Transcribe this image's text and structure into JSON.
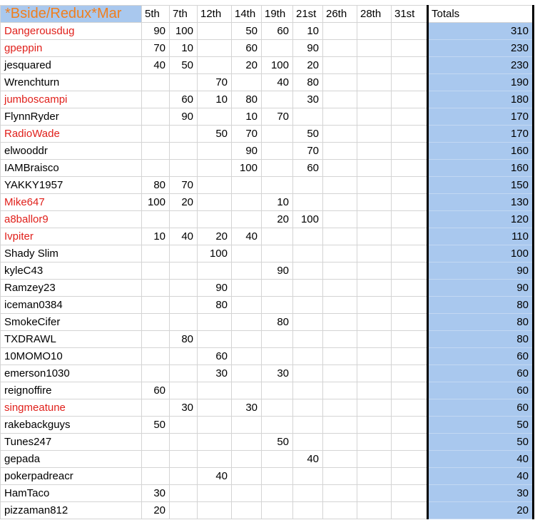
{
  "sheet": {
    "title": "*Bside/Redux*Mar",
    "columns": [
      "5th",
      "7th",
      "12th",
      "14th",
      "19th",
      "21st",
      "26th",
      "28th",
      "31st"
    ],
    "totals_label": "Totals",
    "rows": [
      {
        "name": "Dangerousdug",
        "red": true,
        "v": [
          "90",
          "100",
          "",
          "50",
          "60",
          "10",
          "",
          "",
          ""
        ],
        "total": "310"
      },
      {
        "name": "gpeppin",
        "red": true,
        "v": [
          "70",
          "10",
          "",
          "60",
          "",
          "90",
          "",
          "",
          ""
        ],
        "total": "230"
      },
      {
        "name": "jesquared",
        "red": false,
        "v": [
          "40",
          "50",
          "",
          "20",
          "100",
          "20",
          "",
          "",
          ""
        ],
        "total": "230"
      },
      {
        "name": "Wrenchturn",
        "red": false,
        "v": [
          "",
          "",
          "70",
          "",
          "40",
          "80",
          "",
          "",
          ""
        ],
        "total": "190"
      },
      {
        "name": "jumboscampi",
        "red": true,
        "v": [
          "",
          "60",
          "10",
          "80",
          "",
          "30",
          "",
          "",
          ""
        ],
        "total": "180"
      },
      {
        "name": "FlynnRyder",
        "red": false,
        "v": [
          "",
          "90",
          "",
          "10",
          "70",
          "",
          "",
          "",
          ""
        ],
        "total": "170"
      },
      {
        "name": "RadioWade",
        "red": true,
        "v": [
          "",
          "",
          "50",
          "70",
          "",
          "50",
          "",
          "",
          ""
        ],
        "total": "170"
      },
      {
        "name": "elwooddr",
        "red": false,
        "v": [
          "",
          "",
          "",
          "90",
          "",
          "70",
          "",
          "",
          ""
        ],
        "total": "160"
      },
      {
        "name": "IAMBraisco",
        "red": false,
        "v": [
          "",
          "",
          "",
          "100",
          "",
          "60",
          "",
          "",
          ""
        ],
        "total": "160"
      },
      {
        "name": "YAKKY1957",
        "red": false,
        "v": [
          "80",
          "70",
          "",
          "",
          "",
          "",
          "",
          "",
          ""
        ],
        "total": "150"
      },
      {
        "name": "Mike647",
        "red": true,
        "v": [
          "100",
          "20",
          "",
          "",
          "10",
          "",
          "",
          "",
          ""
        ],
        "total": "130"
      },
      {
        "name": "a8ballor9",
        "red": true,
        "v": [
          "",
          "",
          "",
          "",
          "20",
          "100",
          "",
          "",
          ""
        ],
        "total": "120"
      },
      {
        "name": "Ivpiter",
        "red": true,
        "v": [
          "10",
          "40",
          "20",
          "40",
          "",
          "",
          "",
          "",
          ""
        ],
        "total": "110"
      },
      {
        "name": "Shady Slim",
        "red": false,
        "v": [
          "",
          "",
          "100",
          "",
          "",
          "",
          "",
          "",
          ""
        ],
        "total": "100"
      },
      {
        "name": "kyleC43",
        "red": false,
        "v": [
          "",
          "",
          "",
          "",
          "90",
          "",
          "",
          "",
          ""
        ],
        "total": "90"
      },
      {
        "name": "Ramzey23",
        "red": false,
        "v": [
          "",
          "",
          "90",
          "",
          "",
          "",
          "",
          "",
          ""
        ],
        "total": "90"
      },
      {
        "name": "iceman0384",
        "red": false,
        "v": [
          "",
          "",
          "80",
          "",
          "",
          "",
          "",
          "",
          ""
        ],
        "total": "80"
      },
      {
        "name": "SmokeCifer",
        "red": false,
        "v": [
          "",
          "",
          "",
          "",
          "80",
          "",
          "",
          "",
          ""
        ],
        "total": "80"
      },
      {
        "name": "TXDRAWL",
        "red": false,
        "v": [
          "",
          "80",
          "",
          "",
          "",
          "",
          "",
          "",
          ""
        ],
        "total": "80"
      },
      {
        "name": "10MOMO10",
        "red": false,
        "v": [
          "",
          "",
          "60",
          "",
          "",
          "",
          "",
          "",
          ""
        ],
        "total": "60"
      },
      {
        "name": "emerson1030",
        "red": false,
        "v": [
          "",
          "",
          "30",
          "",
          "30",
          "",
          "",
          "",
          ""
        ],
        "total": "60"
      },
      {
        "name": "reignoffire",
        "red": false,
        "v": [
          "60",
          "",
          "",
          "",
          "",
          "",
          "",
          "",
          ""
        ],
        "total": "60"
      },
      {
        "name": "singmeatune",
        "red": true,
        "v": [
          "",
          "30",
          "",
          "30",
          "",
          "",
          "",
          "",
          ""
        ],
        "total": "60"
      },
      {
        "name": "rakebackguys",
        "red": false,
        "v": [
          "50",
          "",
          "",
          "",
          "",
          "",
          "",
          "",
          ""
        ],
        "total": "50"
      },
      {
        "name": "Tunes247",
        "red": false,
        "v": [
          "",
          "",
          "",
          "",
          "50",
          "",
          "",
          "",
          ""
        ],
        "total": "50"
      },
      {
        "name": "gepada",
        "red": false,
        "v": [
          "",
          "",
          "",
          "",
          "",
          "40",
          "",
          "",
          ""
        ],
        "total": "40"
      },
      {
        "name": "pokerpadreacr",
        "red": false,
        "v": [
          "",
          "",
          "40",
          "",
          "",
          "",
          "",
          "",
          ""
        ],
        "total": "40"
      },
      {
        "name": "HamTaco",
        "red": false,
        "v": [
          "30",
          "",
          "",
          "",
          "",
          "",
          "",
          "",
          ""
        ],
        "total": "30"
      },
      {
        "name": "pizzaman812",
        "red": false,
        "v": [
          "20",
          "",
          "",
          "",
          "",
          "",
          "",
          "",
          ""
        ],
        "total": "20"
      }
    ]
  }
}
